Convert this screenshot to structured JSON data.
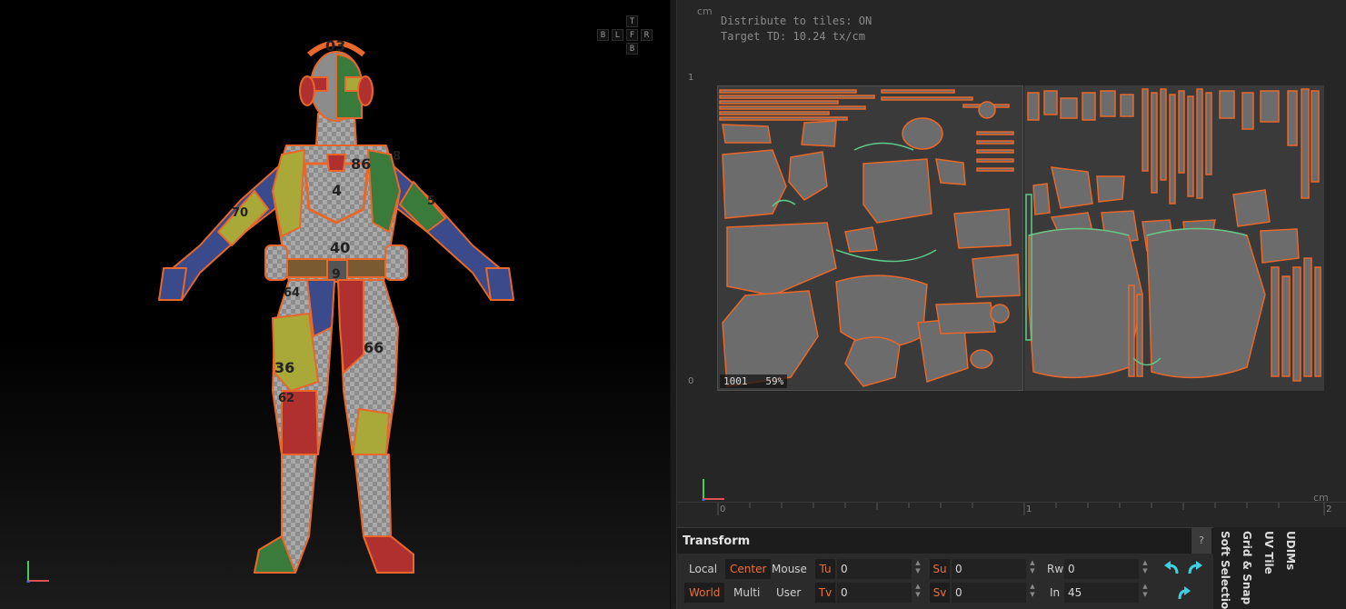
{
  "viewport3d": {
    "navcube": {
      "top": "T",
      "bottom": "B",
      "back": "B",
      "left": "L",
      "front": "F",
      "right": "R"
    },
    "model_numbers": [
      "03",
      "86",
      "4",
      "40",
      "70",
      "5",
      "64",
      "66",
      "36",
      "62",
      "9",
      "8"
    ]
  },
  "uv_editor": {
    "unit_top": "cm",
    "unit_bottom": "cm",
    "distribute_label": "Distribute to tiles: ON",
    "target_td_label": "Target TD: 10.24 tx/cm",
    "ruler_left": [
      "1",
      "0"
    ],
    "ruler_bottom": [
      "0",
      "1",
      "2"
    ],
    "tile_id": "1001",
    "tile_fill": "59%"
  },
  "transform_panel": {
    "title": "Transform",
    "help": "?",
    "space_buttons": {
      "local": "Local",
      "world": "World",
      "center": "Center",
      "multi": "Multi",
      "mouse": "Mouse",
      "user": "User"
    },
    "fields": {
      "tu": {
        "label": "Tu",
        "value": "0"
      },
      "tv": {
        "label": "Tv",
        "value": "0"
      },
      "su": {
        "label": "Su",
        "value": "0"
      },
      "sv": {
        "label": "Sv",
        "value": "0"
      },
      "rw": {
        "label": "Rw",
        "value": "0"
      },
      "in": {
        "label": "In",
        "value": "45"
      }
    }
  },
  "side_tabs": [
    "Soft Selection",
    "Grid & Snap",
    "UV Tile",
    "UDIMs"
  ],
  "colors": {
    "accent": "#e8713c",
    "uv_edge": "#e8672a",
    "uv_seam": "#5fc98b",
    "arrow": "#3fd0e0"
  }
}
